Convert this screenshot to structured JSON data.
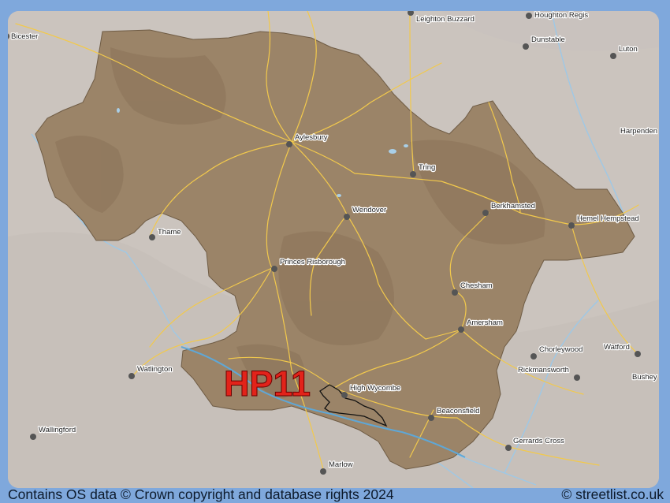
{
  "map": {
    "postcode_area_label": "HP11",
    "colors": {
      "background": "#cbc4be",
      "region_fill": "#9b8468",
      "frame": "#7fa8dc",
      "highlight_label": "#e2231a",
      "roads": "#f2c94c",
      "rivers": "#9ec8e6"
    },
    "towns": [
      {
        "id": "bicester",
        "name": "Bicester"
      },
      {
        "id": "leighton-buzzard",
        "name": "Leighton Buzzard"
      },
      {
        "id": "houghton-regis",
        "name": "Houghton Regis"
      },
      {
        "id": "dunstable",
        "name": "Dunstable"
      },
      {
        "id": "luton",
        "name": "Luton"
      },
      {
        "id": "harpenden",
        "name": "Harpenden"
      },
      {
        "id": "aylesbury",
        "name": "Aylesbury"
      },
      {
        "id": "tring",
        "name": "Tring"
      },
      {
        "id": "berkhamsted",
        "name": "Berkhamsted"
      },
      {
        "id": "hemel-hempstead",
        "name": "Hemel Hempstead"
      },
      {
        "id": "wendover",
        "name": "Wendover"
      },
      {
        "id": "thame",
        "name": "Thame"
      },
      {
        "id": "princes-risborough",
        "name": "Princes Risborough"
      },
      {
        "id": "chesham",
        "name": "Chesham"
      },
      {
        "id": "amersham",
        "name": "Amersham"
      },
      {
        "id": "chorleywood",
        "name": "Chorleywood"
      },
      {
        "id": "watford",
        "name": "Watford"
      },
      {
        "id": "rickmansworth",
        "name": "Rickmansworth"
      },
      {
        "id": "bushey",
        "name": "Bushey"
      },
      {
        "id": "watlington",
        "name": "Watlington"
      },
      {
        "id": "high-wycombe",
        "name": "High Wycombe"
      },
      {
        "id": "beaconsfield",
        "name": "Beaconsfield"
      },
      {
        "id": "gerrards-cross",
        "name": "Gerrards Cross"
      },
      {
        "id": "wallingford",
        "name": "Wallingford"
      },
      {
        "id": "marlow",
        "name": "Marlow"
      }
    ]
  },
  "footer": {
    "attribution": "Contains OS data © Crown copyright and database rights 2024",
    "site": "© streetlist.co.uk"
  }
}
